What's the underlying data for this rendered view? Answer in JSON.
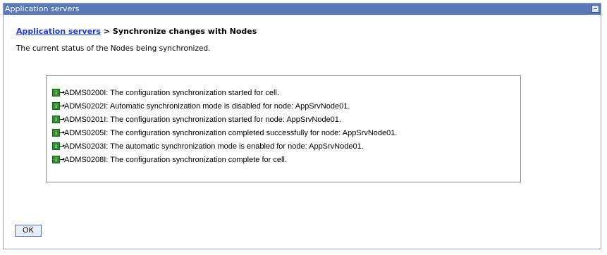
{
  "panel": {
    "title": "Application servers"
  },
  "breadcrumb": {
    "link": "Application servers",
    "separator": " > ",
    "current": "Synchronize changes with Nodes"
  },
  "description": "The current status of the Nodes being synchronized.",
  "messages": [
    {
      "icon": "info-icon",
      "text": "ADMS0200I: The configuration synchronization started for cell."
    },
    {
      "icon": "info-icon",
      "text": "ADMS0202I: Automatic synchronization mode is disabled for node: AppSrvNode01."
    },
    {
      "icon": "info-icon",
      "text": "ADMS0201I: The configuration synchronization started for node: AppSrvNode01."
    },
    {
      "icon": "info-icon",
      "text": "ADMS0205I: The configuration synchronization completed successfully for node: AppSrvNode01."
    },
    {
      "icon": "info-icon",
      "text": "ADMS0203I: The automatic synchronization mode is enabled for node: AppSrvNode01."
    },
    {
      "icon": "info-icon",
      "text": "ADMS0208I: The configuration synchronization complete for cell."
    }
  ],
  "buttons": {
    "ok": "OK"
  },
  "colors": {
    "titlebar": "#5a78b3",
    "link": "#1f3cc0",
    "info_icon": "#2f8f2f"
  }
}
